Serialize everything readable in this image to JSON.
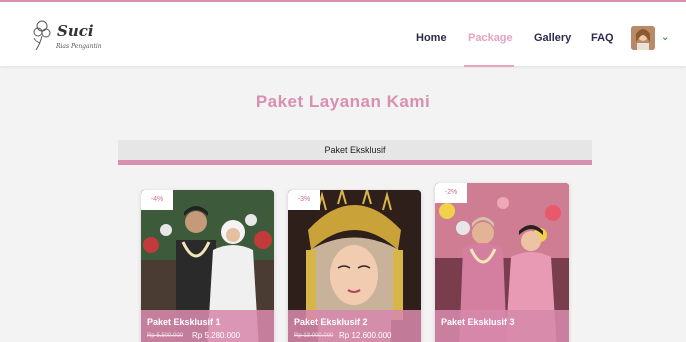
{
  "brand": {
    "name": "Suci",
    "tagline": "Rias Pengantin"
  },
  "nav": {
    "items": [
      {
        "label": "Home"
      },
      {
        "label": "Package",
        "active": true
      },
      {
        "label": "Gallery"
      },
      {
        "label": "FAQ"
      }
    ],
    "avatar_icon": "user-avatar",
    "dropdown_icon": "chevron-down-icon"
  },
  "main": {
    "title": "Paket Layanan Kami",
    "tab_label": "Paket Eksklusif",
    "cards": [
      {
        "discount": "-4%",
        "title": "Paket Eksklusif 1",
        "price_old": "Rp 5.500.000",
        "price_new": "Rp 5.280.000"
      },
      {
        "discount": "-3%",
        "title": "Paket Eksklusif 2",
        "price_old": "Rp 13.000.000",
        "price_new": "Rp 12.600.000"
      },
      {
        "discount": "-2%",
        "title": "Paket Eksklusif 3"
      }
    ]
  },
  "colors": {
    "accent": "#d98fb0",
    "nav_text": "#2b2d4a",
    "tab_bg": "#e6e6e6",
    "badge_text": "#d36a8e"
  }
}
